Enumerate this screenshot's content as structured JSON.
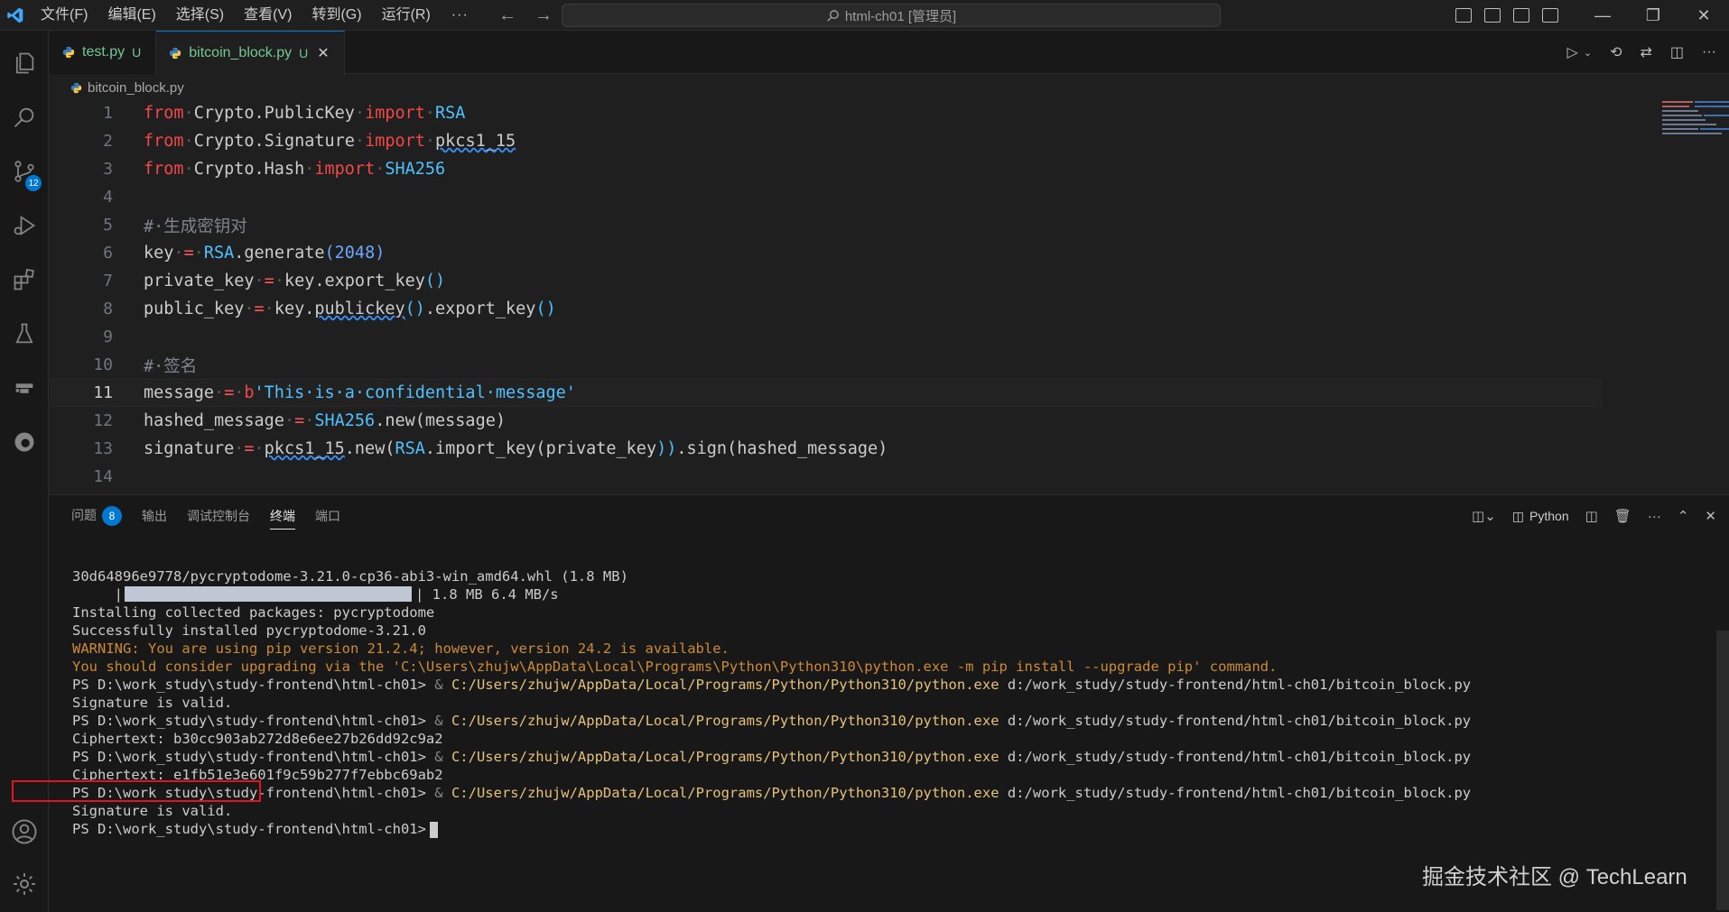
{
  "titlebar": {
    "menus": [
      "文件(F)",
      "编辑(E)",
      "选择(S)",
      "查看(V)",
      "转到(G)",
      "运行(R)"
    ],
    "more": "···",
    "search": "html-ch01 [管理员]"
  },
  "activity": {
    "source_control_badge": "12"
  },
  "tabs": [
    {
      "label": "test.py",
      "status": "U",
      "active": false
    },
    {
      "label": "bitcoin_block.py",
      "status": "U",
      "active": true
    }
  ],
  "breadcrumb": "bitcoin_block.py",
  "code_lines": [
    "1",
    "2",
    "3",
    "4",
    "5",
    "6",
    "7",
    "8",
    "9",
    "10",
    "11",
    "12",
    "13",
    "14"
  ],
  "code": {
    "l1": {
      "kw1": "from",
      "mod": "Crypto.PublicKey",
      "kw2": "import",
      "name": "RSA"
    },
    "l2": {
      "kw1": "from",
      "mod": "Crypto.Signature",
      "kw2": "import",
      "name": "pkcs1_15"
    },
    "l3": {
      "kw1": "from",
      "mod": "Crypto.Hash",
      "kw2": "import",
      "name": "SHA256"
    },
    "l5": "#·生成密钥对",
    "l6": {
      "a": "key",
      "b": "RSA",
      "c": ".generate",
      "d": "(2048)"
    },
    "l7": {
      "a": "private_key",
      "b": "key.export_key",
      "c": "()"
    },
    "l8": {
      "a": "public_key",
      "b": "key.",
      "c": "publickey",
      "d": "()",
      "e": ".export_key",
      "f": "()"
    },
    "l10": "#·签名",
    "l11": {
      "a": "message",
      "b": "b",
      "c": "'This·is·a·confidential·message'"
    },
    "l12": {
      "a": "hashed_message",
      "b": "SHA256",
      "c": ".new(message)"
    },
    "l13": {
      "a": "signature",
      "b": "pkcs1_15",
      "c": ".new(",
      "d": "RSA",
      "e": ".import_key(",
      "f": "private_key",
      "g": "))",
      "h": ".sign(hashed_message)"
    }
  },
  "panel": {
    "tabs": [
      "问题",
      "输出",
      "调试控制台",
      "终端",
      "端口"
    ],
    "problems_count": "8",
    "active_tab": "终端",
    "terminal_profile": "Python"
  },
  "terminal": {
    "l1": "30d64896e9778/pycryptodome-3.21.0-cp36-abi3-win_amd64.whl (1.8 MB)",
    "l2_prefix": "     |",
    "l2_suffix": "| 1.8 MB 6.4 MB/s",
    "l3": "Installing collected packages: pycryptodome",
    "l4": "Successfully installed pycryptodome-3.21.0",
    "l5": "WARNING: You are using pip version 21.2.4; however, version 24.2 is available.",
    "l6": "You should consider upgrading via the 'C:\\Users\\zhujw\\AppData\\Local\\Programs\\Python\\Python310\\python.exe -m pip install --upgrade pip' command.",
    "prompt": "PS D:\\work_study\\study-frontend\\html-ch01> ",
    "amp": "& ",
    "exe": "C:/Users/zhujw/AppData/Local/Programs/Python/Python310/python.exe",
    "script": " d:/work_study/study-frontend/html-ch01/bitcoin_block.py",
    "valid": "Signature is valid.",
    "cipher1": "Ciphertext: b30cc903ab272d8e6ee27b26dd92c9a2",
    "cipher2": "Ciphertext: e1fb51e3e601f9c59b277f7ebbc69ab2",
    "last_prompt": "PS D:\\work_study\\study-frontend\\html-ch01>"
  },
  "watermark": "掘金技术社区 @ TechLearn"
}
